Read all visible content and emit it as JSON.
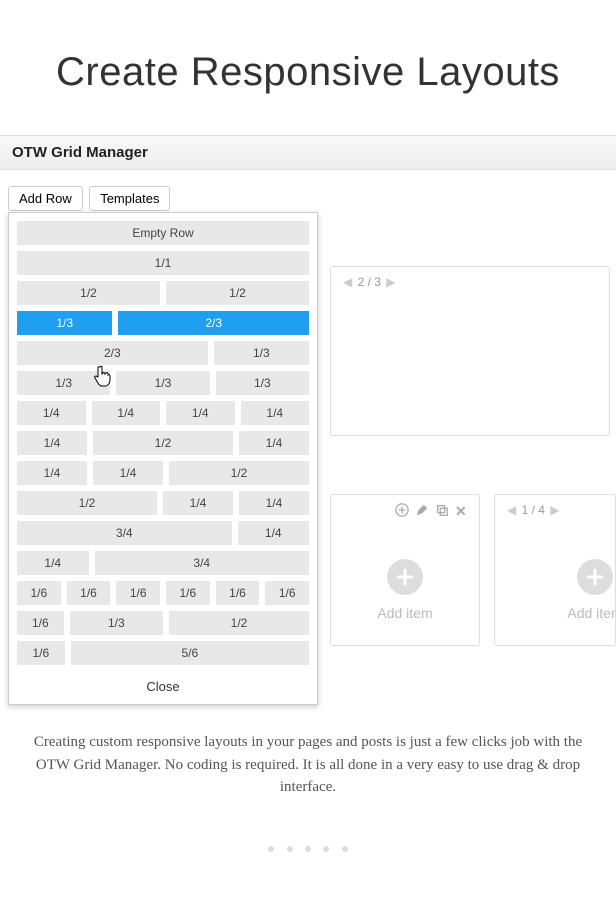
{
  "hero_title": "Create Responsive Layouts",
  "panel_title": "OTW Grid Manager",
  "tabs": {
    "add_row": "Add Row",
    "templates": "Templates"
  },
  "dropdown": {
    "empty_row": "Empty Row",
    "close": "Close",
    "rows": [
      {
        "cols": [
          {
            "label": "1/1",
            "w": 1
          }
        ]
      },
      {
        "cols": [
          {
            "label": "1/2",
            "w": 1
          },
          {
            "label": "1/2",
            "w": 1
          }
        ]
      },
      {
        "cols": [
          {
            "label": "1/3",
            "w": 1,
            "sel": true
          },
          {
            "label": "2/3",
            "w": 2,
            "sel": true
          }
        ]
      },
      {
        "cols": [
          {
            "label": "2/3",
            "w": 2
          },
          {
            "label": "1/3",
            "w": 1
          }
        ]
      },
      {
        "cols": [
          {
            "label": "1/3",
            "w": 1
          },
          {
            "label": "1/3",
            "w": 1
          },
          {
            "label": "1/3",
            "w": 1
          }
        ]
      },
      {
        "cols": [
          {
            "label": "1/4",
            "w": 1
          },
          {
            "label": "1/4",
            "w": 1
          },
          {
            "label": "1/4",
            "w": 1
          },
          {
            "label": "1/4",
            "w": 1
          }
        ]
      },
      {
        "cols": [
          {
            "label": "1/4",
            "w": 1
          },
          {
            "label": "1/2",
            "w": 2
          },
          {
            "label": "1/4",
            "w": 1
          }
        ]
      },
      {
        "cols": [
          {
            "label": "1/4",
            "w": 1
          },
          {
            "label": "1/4",
            "w": 1
          },
          {
            "label": "1/2",
            "w": 2
          }
        ]
      },
      {
        "cols": [
          {
            "label": "1/2",
            "w": 2
          },
          {
            "label": "1/4",
            "w": 1
          },
          {
            "label": "1/4",
            "w": 1
          }
        ]
      },
      {
        "cols": [
          {
            "label": "3/4",
            "w": 3
          },
          {
            "label": "1/4",
            "w": 1
          }
        ]
      },
      {
        "cols": [
          {
            "label": "1/4",
            "w": 1
          },
          {
            "label": "3/4",
            "w": 3
          }
        ]
      },
      {
        "cols": [
          {
            "label": "1/6",
            "w": 1
          },
          {
            "label": "1/6",
            "w": 1
          },
          {
            "label": "1/6",
            "w": 1
          },
          {
            "label": "1/6",
            "w": 1
          },
          {
            "label": "1/6",
            "w": 1
          },
          {
            "label": "1/6",
            "w": 1
          }
        ]
      },
      {
        "cols": [
          {
            "label": "1/6",
            "w": 1
          },
          {
            "label": "1/3",
            "w": 2
          },
          {
            "label": "1/2",
            "w": 3
          }
        ]
      },
      {
        "cols": [
          {
            "label": "1/6",
            "w": 1
          },
          {
            "label": "5/6",
            "w": 5
          }
        ]
      }
    ]
  },
  "card1": {
    "pager": "2 / 3"
  },
  "card2": {
    "pager": "1 / 4",
    "add_label": "Add item"
  },
  "add_item_label": "Add item",
  "description": "Creating custom responsive layouts in your pages and posts is just a few  clicks job with the OTW Grid Manager. No coding is required. It is all done in a very easy to use drag & drop interface."
}
